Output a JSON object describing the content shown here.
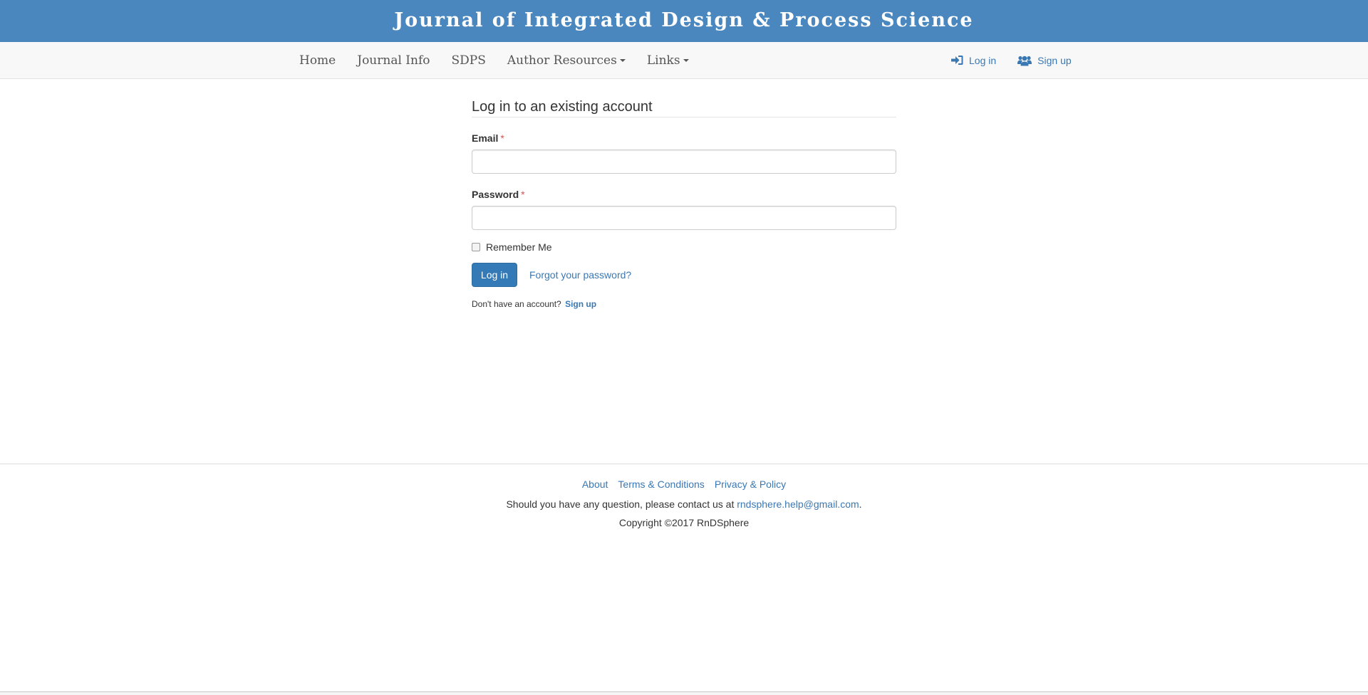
{
  "header": {
    "title": "Journal of Integrated Design & Process Science"
  },
  "nav": {
    "items": [
      {
        "label": "Home",
        "dropdown": false
      },
      {
        "label": "Journal Info",
        "dropdown": false
      },
      {
        "label": "SDPS",
        "dropdown": false
      },
      {
        "label": "Author Resources",
        "dropdown": true
      },
      {
        "label": "Links",
        "dropdown": true
      }
    ],
    "login_label": "Log in",
    "signup_label": "Sign up"
  },
  "form": {
    "title": "Log in to an existing account",
    "email_label": "Email",
    "password_label": "Password",
    "required_mark": "*",
    "email_value": "",
    "password_value": "",
    "remember_label": "Remember Me",
    "remember_checked": false,
    "submit_label": "Log in",
    "forgot_label": "Forgot your password?",
    "no_account_text": "Don't have an account?",
    "signup_label": "Sign up"
  },
  "footer": {
    "links": [
      "About",
      "Terms & Conditions",
      "Privacy & Policy"
    ],
    "contact_text": "Should you have any question, please contact us at",
    "contact_email": "rndsphere.help@gmail.com",
    "contact_end": ".",
    "copyright": "Copyright ©2017 RnDSphere"
  },
  "colors": {
    "banner": "#4a87bf",
    "link": "#3a78b4",
    "primary_button": "#337ab7",
    "required": "#d9534f"
  },
  "icons": [
    "sign-in-icon",
    "users-icon",
    "caret-down-icon"
  ]
}
